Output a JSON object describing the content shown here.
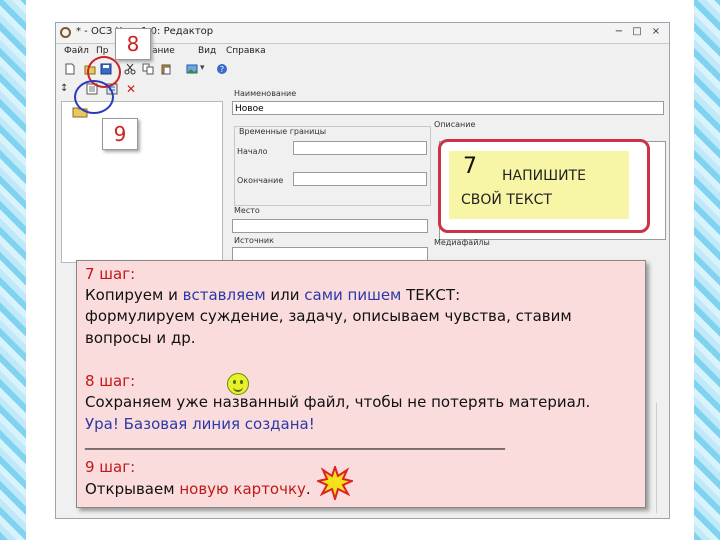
{
  "window": {
    "title": "* - ОСЗ Х      ер 1.0: Редактор",
    "buttons": [
      "−",
      "□",
      "×"
    ]
  },
  "menu": [
    "Файл",
    "Пр",
    "ание",
    "Вид",
    "Справка"
  ],
  "form": {
    "name_label": "Наименование",
    "name_value": "Новое",
    "time_group_label": "Временные границы",
    "start_label": "Начало",
    "end_label": "Окончание",
    "place_label": "Место",
    "source_label": "Источник",
    "description_label": "Описание",
    "media_label": "Медиафайлы"
  },
  "note": {
    "number": "7",
    "line1": "НАПИШИТЕ",
    "line2": "СВОЙ ТЕКСТ"
  },
  "callouts": {
    "save": "8",
    "new_card": "9"
  },
  "instructions": {
    "step7_title": "7 шаг:",
    "step7_line1_a": "Копируем и ",
    "step7_line1_b": "вставляем",
    "step7_line1_c": " или ",
    "step7_line1_d": "сами пишем",
    "step7_line1_e": " ТЕКСТ:",
    "step7_line2": "формулируем суждение, задачу, описываем чувства, ставим",
    "step7_line3": "вопросы и др.",
    "step8_title": "8 шаг:",
    "step8_line1": "Сохраняем уже названный файл, чтобы не потерять материал.",
    "step8_line2": "Ура! Базовая линия создана!",
    "divider": "________________________________________________________",
    "step9_title": "9 шаг:",
    "step9_line_a": "Открываем ",
    "step9_line_b": "новую карточку",
    "step9_line_c": "."
  },
  "colors": {
    "highlight_red": "#cc3344",
    "note_yellow": "#f7f5a6",
    "panel_pink": "#fbdcdc",
    "step_red": "#c01818",
    "accent_blue": "#2a3aa8"
  }
}
